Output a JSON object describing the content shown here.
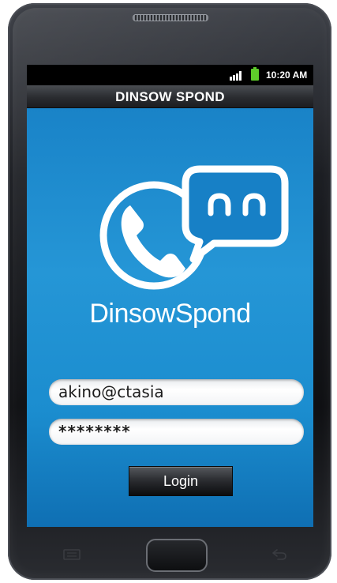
{
  "status_bar": {
    "time": "10:20 AM",
    "signal_icon": "signal-bars-icon",
    "battery_icon": "battery-icon"
  },
  "app_bar": {
    "title": "DINSOW SPOND"
  },
  "brand": {
    "logo_icon": "phone-chat-logo-icon",
    "name": "DinsowSpond"
  },
  "login_form": {
    "username_value": "akino@ctasia",
    "password_value": "********",
    "login_label": "Login"
  },
  "hardware_keys": {
    "menu_icon": "menu-key-icon",
    "home_icon": "home-key-icon",
    "back_icon": "back-key-icon"
  },
  "colors": {
    "screen_blue": "#1b8dcf",
    "battery_green": "#5ecb2a",
    "button_dark": "#2c2e32"
  }
}
